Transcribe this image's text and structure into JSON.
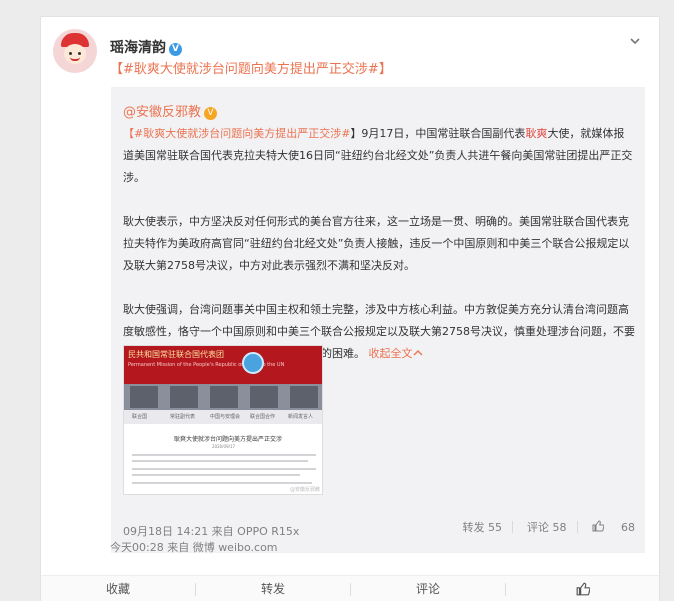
{
  "post": {
    "username": "瑶海清韵",
    "verified_mark": "V",
    "title_open": "【",
    "title_tag": "#耿爽大使就涉台问题向美方提出严正交涉#",
    "title_close": "】"
  },
  "quote": {
    "author": "@安徽反邪教",
    "verified_mark": "V",
    "p1_open": "【",
    "p1_tag": "#耿爽大使就涉台问题向美方提出严正交涉#",
    "p1_after_tag": "】9月17日，中国常驻联合国副代表",
    "p1_name": "耿爽",
    "p1_rest": "大使，就媒体报道美国常驻联合国代表克拉夫特大使16日同“驻纽约台北经文处”负责人共进午餐向美国常驻团提出严正交涉。",
    "p2": "耿大使表示，中方坚决反对任何形式的美台官方往来，这一立场是一贯、明确的。美国常驻联合国代表克拉夫特作为美政府高官同“驻纽约台北经文处”负责人接触，违反一个中国原则和中美三个联合公报规定以及联大第2758号决议，中方对此表示强烈不满和坚决反对。",
    "p3": "耿大使强调，台湾问题事关中国主权和领土完整，涉及中方核心利益。中方敦促美方充分认清台湾问题高度敏感性，恪守一个中国原则和中美三个联合公报规定以及联大第2758号决议，慎重处理涉台问题，不要给中美关系和两国在联合国的合作制造新的困难。",
    "collapse": "收起全文",
    "image": {
      "banner": "民共和国常驻联合国代表团",
      "banner_sub": "Permanent Mission of the People's Republic of China to the UN",
      "captions": [
        "联合国",
        "常驻副代表",
        "中国与安理会",
        "联合国合作",
        "新闻发言人"
      ],
      "doc_title": "耿爽大使就涉台问题向美方提出严正交涉",
      "doc_date": "2020/09/17",
      "watermark": "@安徽反邪教"
    },
    "meta": "09月18日 14:21 来自 OPPO R15x",
    "repost": "转发 55",
    "comment": "评论 58",
    "likes": "68"
  },
  "post_meta": "今天00:28 来自 微博 weibo.com",
  "footer": {
    "favorite": "收藏",
    "repost": "转发",
    "comment": "评论"
  },
  "icons": {
    "chevron": "chevron-down-icon",
    "like": "thumbs-up-icon"
  },
  "colors": {
    "tag": "#eb7350",
    "highlight": "#e1473a",
    "verified": "#3b9ae3"
  }
}
